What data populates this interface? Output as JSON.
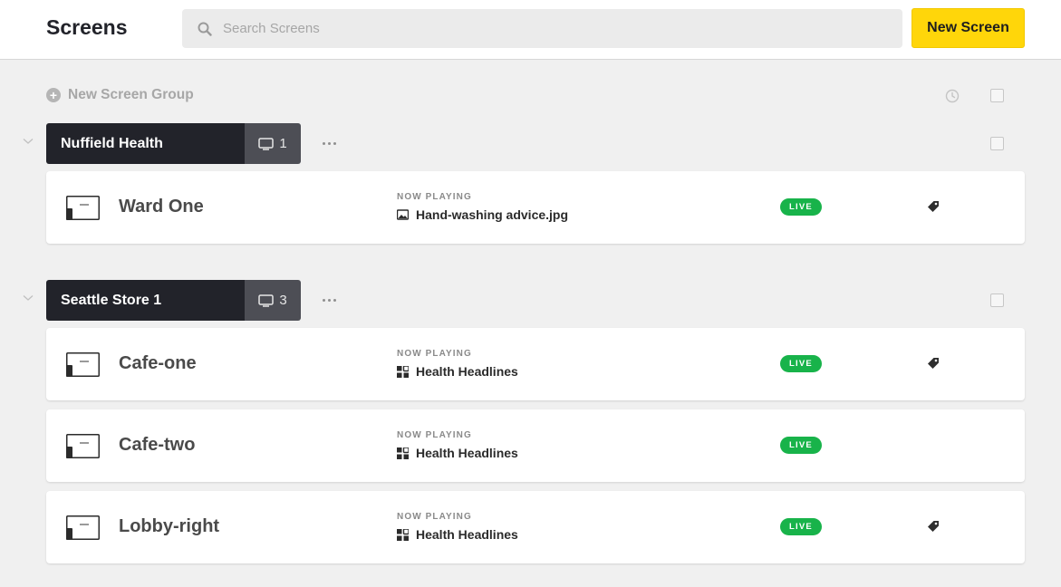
{
  "header": {
    "title": "Screens",
    "search_placeholder": "Search Screens",
    "new_screen_label": "New Screen"
  },
  "toolbar": {
    "new_group_label": "New Screen Group"
  },
  "groups": [
    {
      "name": "Nuffield Health",
      "count": "1",
      "screens": [
        {
          "name": "Ward One",
          "now_playing_label": "NOW PLAYING",
          "content": "Hand-washing advice.jpg",
          "content_icon": "image-icon",
          "status": "LIVE",
          "has_tag": true
        }
      ]
    },
    {
      "name": "Seattle Store 1",
      "count": "3",
      "screens": [
        {
          "name": "Cafe-one",
          "now_playing_label": "NOW PLAYING",
          "content": "Health Headlines",
          "content_icon": "app-grid-icon",
          "status": "LIVE",
          "has_tag": true
        },
        {
          "name": "Cafe-two",
          "now_playing_label": "NOW PLAYING",
          "content": "Health Headlines",
          "content_icon": "app-grid-icon",
          "status": "LIVE",
          "has_tag": false
        },
        {
          "name": "Lobby-right",
          "now_playing_label": "NOW PLAYING",
          "content": "Health Headlines",
          "content_icon": "app-grid-icon",
          "status": "LIVE",
          "has_tag": true
        }
      ]
    }
  ],
  "colors": {
    "accent": "#ffd60a",
    "live": "#18b34a",
    "group_dark": "#22232a",
    "group_count": "#4d4e55"
  }
}
